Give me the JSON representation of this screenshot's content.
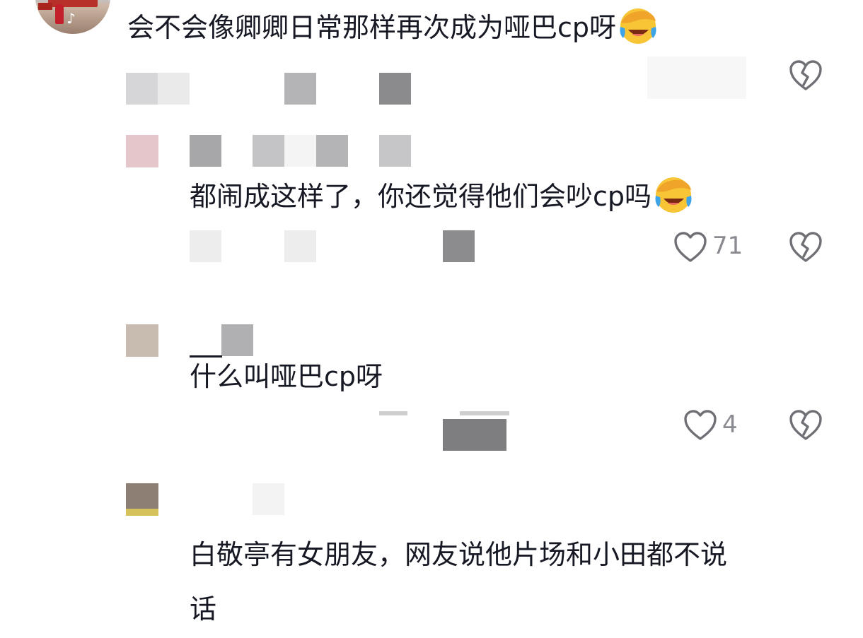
{
  "comments": [
    {
      "text": "会不会像卿卿日常那样再次成为哑巴cp呀",
      "emoji": "rofl-face"
    },
    {
      "text": "都闹成这样了，你还觉得他们会吵cp吗",
      "emoji": "rofl-face",
      "likes": "71"
    },
    {
      "text": "什么叫哑巴cp呀",
      "likes": "4"
    },
    {
      "text_line1": "白敬亭有女朋友，网友说他片场和小田都不说",
      "text_line2": "话"
    }
  ],
  "icons": {
    "like": "heart-outline-icon",
    "dislike": "broken-heart-icon",
    "app_badge": "tiktok-logo-icon"
  },
  "colors": {
    "text": "#161823",
    "muted": "#8a8b91",
    "icon_stroke": "#6f7075",
    "emoji_yellow": "#f7c536",
    "emoji_tear": "#3fa3e8"
  }
}
